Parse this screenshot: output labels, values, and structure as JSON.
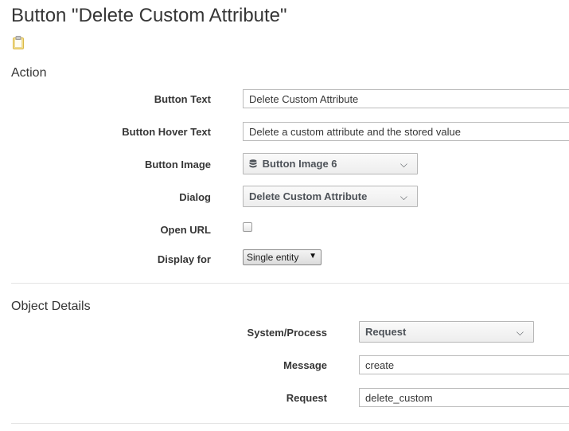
{
  "page": {
    "title": "Button \"Delete Custom Attribute\""
  },
  "action": {
    "heading": "Action",
    "button_text_label": "Button Text",
    "button_text_value": "Delete Custom Attribute",
    "hover_text_label": "Button Hover Text",
    "hover_text_value": "Delete a custom attribute and the stored value",
    "button_image_label": "Button Image",
    "button_image_value": "Button Image 6",
    "dialog_label": "Dialog",
    "dialog_value": "Delete Custom Attribute",
    "open_url_label": "Open URL",
    "open_url_checked": false,
    "display_for_label": "Display for",
    "display_for_value": "Single entity"
  },
  "object_details": {
    "heading": "Object Details",
    "system_process_label": "System/Process",
    "system_process_value": "Request",
    "message_label": "Message",
    "message_value": "create",
    "request_label": "Request",
    "request_value": "delete_custom"
  },
  "icons": {
    "page_icon": "clipboard-icon",
    "button_image_icon": "database-icon",
    "dropdown_icon": "chevron-down-icon"
  },
  "colors": {
    "text": "#363636",
    "border": "#bbbbbb",
    "icon_accent": "#f0c419"
  }
}
